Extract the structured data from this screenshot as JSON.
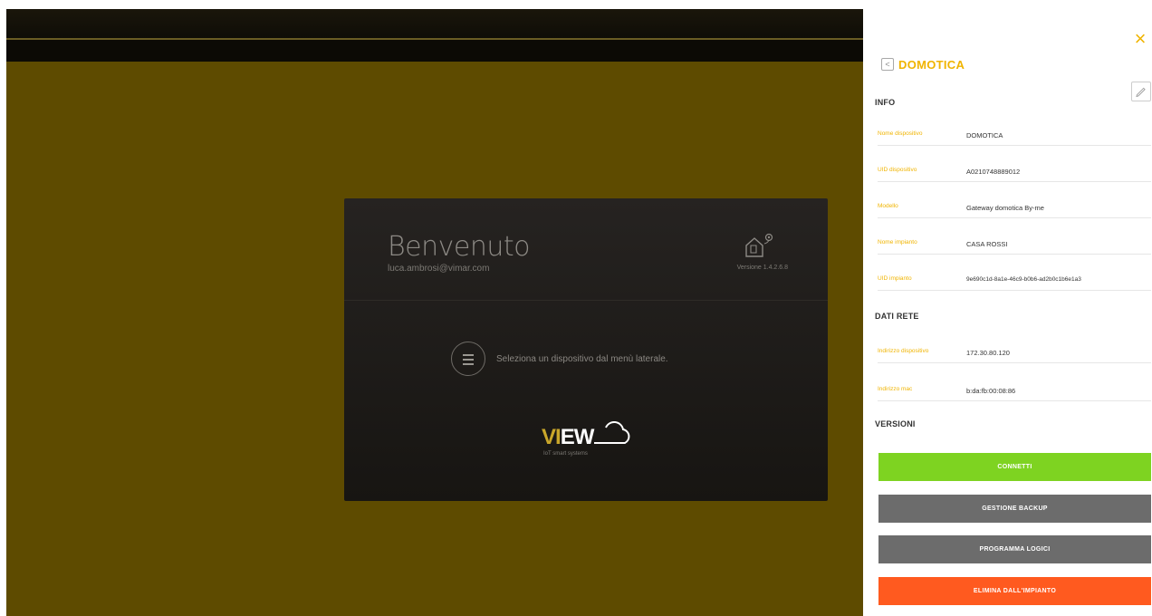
{
  "colors": {
    "accent": "#f0b400",
    "background": "#5e4b00",
    "card": "#1e1c19",
    "connect": "#7ed321",
    "secondary": "#6c6c6c",
    "danger": "#ff5a1f"
  },
  "welcome": {
    "title": "Benvenuto",
    "email": "luca.ambrosi@vimar.com",
    "version": "Versione 1.4.2.6.8",
    "message": "Seleziona un dispositivo dal menù laterale.",
    "logo_vi": "VI",
    "logo_ew": "EW",
    "logo_tagline": "IoT smart systems",
    "icon_house": "house-settings-icon",
    "icon_menu": "menu-icon"
  },
  "panel": {
    "title": "DOMOTICA",
    "close_label": "×",
    "back_label": "<",
    "sections": {
      "info": "INFO",
      "network": "DATI RETE",
      "version": "VERSIONI"
    },
    "info_rows": [
      {
        "label": "Nome dispositivo",
        "value": "DOMOTICA"
      },
      {
        "label": "UID dispositivo",
        "value": "A0210748889012"
      },
      {
        "label": "Modello",
        "value": "Gateway domotica By-me"
      },
      {
        "label": "Nome impianto",
        "value": "CASA ROSSI"
      },
      {
        "label": "UID impianto",
        "value": "9e690c1d-8a1e-46c9-b0b6-ad2b0c1b6e1a3"
      }
    ],
    "network_rows": [
      {
        "label": "Indirizzo dispositivo",
        "value": "172.30.80.120"
      },
      {
        "label": "Indirizzo mac",
        "value": "b:da:fb:00:08:86"
      }
    ],
    "buttons": {
      "connect": "CONNETTI",
      "backup": "GESTIONE BACKUP",
      "logic": "PROGRAMMA LOGICI",
      "remove": "ELIMINA DALL'IMPIANTO"
    }
  }
}
